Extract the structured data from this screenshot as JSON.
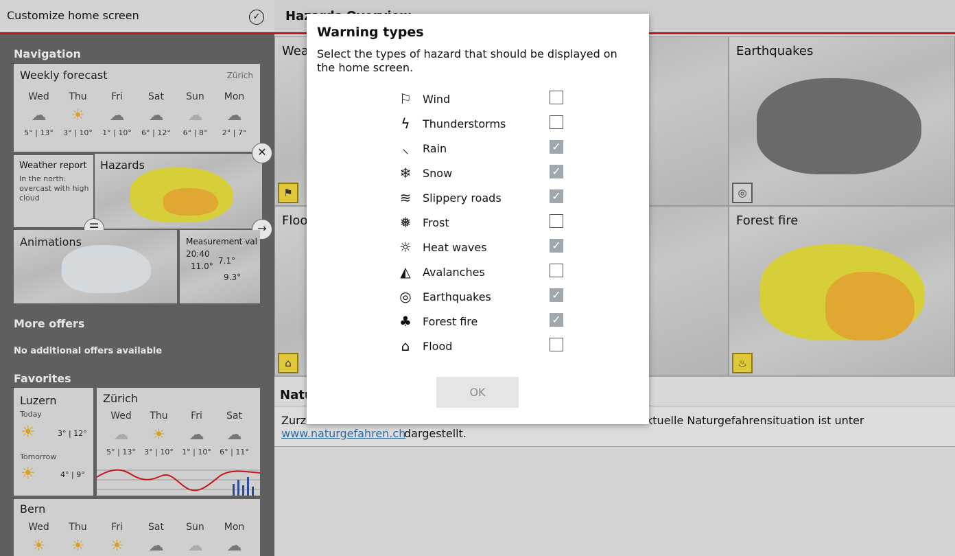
{
  "left_panel": {
    "title": "Customize home screen",
    "check_icon": "check-circle-icon",
    "navigation_title": "Navigation",
    "weekly_forecast": {
      "title": "Weekly forecast",
      "location": "Zürich",
      "days": [
        {
          "day": "Wed",
          "icon": "cloud-rain-icon",
          "temps": "5° | 13°"
        },
        {
          "day": "Thu",
          "icon": "sun-icon",
          "temps": "3° | 10°"
        },
        {
          "day": "Fri",
          "icon": "cloud-rain-icon",
          "temps": "1° | 10°"
        },
        {
          "day": "Sat",
          "icon": "cloud-rain-icon",
          "temps": "6° | 12°"
        },
        {
          "day": "Sun",
          "icon": "cloud-icon",
          "temps": "6° | 8°"
        },
        {
          "day": "Mon",
          "icon": "cloud-rain-icon",
          "temps": "2° | 7°"
        }
      ]
    },
    "weather_report": {
      "title": "Weather report",
      "text": "In the north: overcast with high cloud"
    },
    "hazards_tile": {
      "title": "Hazards"
    },
    "animations_tile": {
      "title": "Animations"
    },
    "measurement_tile": {
      "title": "Measurement val",
      "time": "20:40",
      "values": [
        "11.0°",
        "7.1°",
        "9.3°"
      ]
    },
    "more_offers_title": "More offers",
    "no_offers_text": "No additional offers available",
    "favorites_title": "Favorites",
    "luzern": {
      "title": "Luzern",
      "today_label": "Today",
      "today_temps": "3° | 12°",
      "tomorrow_label": "Tomorrow",
      "tomorrow_temps": "4° | 9°"
    },
    "zurich_fav": {
      "title": "Zürich",
      "days": [
        {
          "day": "Wed",
          "icon": "cloud-icon",
          "temps": "5° | 13°"
        },
        {
          "day": "Thu",
          "icon": "sun-icon",
          "temps": "3° | 10°"
        },
        {
          "day": "Fri",
          "icon": "cloud-rain-icon",
          "temps": "1° | 10°"
        },
        {
          "day": "Sat",
          "icon": "cloud-rain-icon",
          "temps": "6° | 11°"
        }
      ]
    },
    "bern": {
      "title": "Bern",
      "days": [
        {
          "day": "Wed",
          "icon": "sun-cloud-icon"
        },
        {
          "day": "Thu",
          "icon": "sun-icon"
        },
        {
          "day": "Fri",
          "icon": "sun-cloud-icon"
        },
        {
          "day": "Sat",
          "icon": "cloud-rain-icon"
        },
        {
          "day": "Sun",
          "icon": "cloud-icon"
        },
        {
          "day": "Mon",
          "icon": "cloud-rain-icon"
        }
      ]
    }
  },
  "right_panel": {
    "title": "Hazards Overview",
    "tiles": [
      {
        "title": "Wea"
      },
      {
        "title": "Earthquakes"
      },
      {
        "title": "Floo"
      },
      {
        "title": "Forest fire"
      }
    ],
    "natur": {
      "title": "Natu",
      "text_start": "Zurze",
      "text_end": "ktuelle Naturgefahrensituation ist unter",
      "link": "www.naturgefahren.ch",
      "link_after": "dargestellt."
    }
  },
  "dialog": {
    "title": "Warning types",
    "description": "Select the types of hazard that should be displayed on the home screen.",
    "options": [
      {
        "label": "Wind",
        "icon": "wind-flag-icon",
        "checked": false
      },
      {
        "label": "Thunderstorms",
        "icon": "lightning-icon",
        "checked": false
      },
      {
        "label": "Rain",
        "icon": "rain-drops-icon",
        "checked": true
      },
      {
        "label": "Snow",
        "icon": "snowflake-icon",
        "checked": true
      },
      {
        "label": "Slippery roads",
        "icon": "slippery-road-icon",
        "checked": true
      },
      {
        "label": "Frost",
        "icon": "thermometer-snow-icon",
        "checked": false
      },
      {
        "label": "Heat waves",
        "icon": "thermometer-sun-icon",
        "checked": true
      },
      {
        "label": "Avalanches",
        "icon": "avalanche-icon",
        "checked": false
      },
      {
        "label": "Earthquakes",
        "icon": "earthquake-icon",
        "checked": true
      },
      {
        "label": "Forest fire",
        "icon": "forest-fire-icon",
        "checked": true
      },
      {
        "label": "Flood",
        "icon": "flood-house-icon",
        "checked": false
      }
    ],
    "ok_label": "OK"
  },
  "colors": {
    "accent_red": "#c4161c",
    "hazard_yellow": "#d7cf3a",
    "hazard_orange": "#e0a832",
    "checkbox_checked": "#9fa8ad"
  }
}
